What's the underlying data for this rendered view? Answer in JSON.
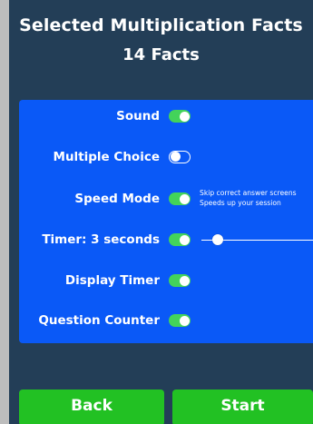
{
  "header": {
    "title": "Selected Multiplication Facts",
    "subtitle": "14 Facts"
  },
  "settings": {
    "sound": {
      "label": "Sound",
      "enabled": true
    },
    "multiple_choice": {
      "label": "Multiple Choice",
      "enabled": false
    },
    "speed_mode": {
      "label": "Speed Mode",
      "enabled": true,
      "helper_line1": "Skip correct answer screens",
      "helper_line2": "Speeds up your session"
    },
    "timer": {
      "label": "Timer:  3 seconds",
      "enabled": true,
      "seconds": 3
    },
    "display_timer": {
      "label": "Display Timer",
      "enabled": true
    },
    "question_counter": {
      "label": "Question Counter",
      "enabled": true
    }
  },
  "buttons": {
    "back": "Back",
    "start": "Start"
  },
  "colors": {
    "background": "#233e57",
    "panel": "#0a59f7",
    "toggle_on": "#43d35a",
    "button": "#22c123",
    "outer_frame": "#bdbdbd"
  }
}
